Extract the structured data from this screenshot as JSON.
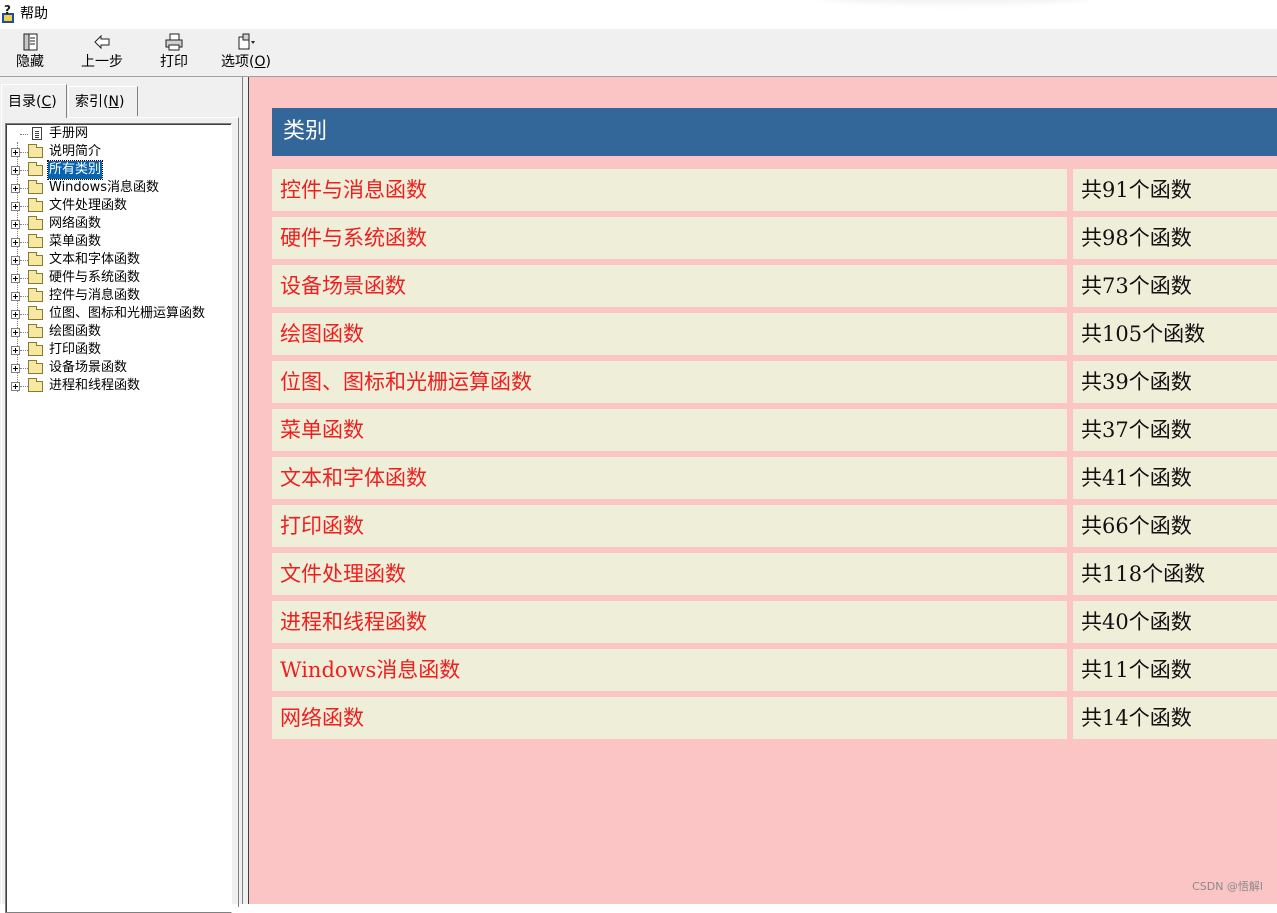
{
  "window": {
    "title": "帮助"
  },
  "toolbar": {
    "hide_label": "隐藏",
    "back_label": "上一步",
    "print_label": "打印",
    "options_label_pre": "选项(",
    "options_label_key": "O",
    "options_label_post": ")"
  },
  "tabs": {
    "contents_pre": "目录(",
    "contents_key": "C",
    "contents_post": ")",
    "index_pre": "索引(",
    "index_key": "N",
    "index_post": ")"
  },
  "tree": {
    "items": [
      {
        "label": "手册网",
        "icon": "document",
        "expandable": false,
        "selected": false
      },
      {
        "label": "说明简介",
        "icon": "folder",
        "expandable": true,
        "selected": false
      },
      {
        "label": "所有类别",
        "icon": "folder",
        "expandable": true,
        "selected": true
      },
      {
        "label": "Windows消息函数",
        "icon": "folder",
        "expandable": true,
        "selected": false
      },
      {
        "label": "文件处理函数",
        "icon": "folder",
        "expandable": true,
        "selected": false
      },
      {
        "label": "网络函数",
        "icon": "folder",
        "expandable": true,
        "selected": false
      },
      {
        "label": "菜单函数",
        "icon": "folder",
        "expandable": true,
        "selected": false
      },
      {
        "label": "文本和字体函数",
        "icon": "folder",
        "expandable": true,
        "selected": false
      },
      {
        "label": "硬件与系统函数",
        "icon": "folder",
        "expandable": true,
        "selected": false
      },
      {
        "label": "控件与消息函数",
        "icon": "folder",
        "expandable": true,
        "selected": false
      },
      {
        "label": "位图、图标和光栅运算函数",
        "icon": "folder",
        "expandable": true,
        "selected": false
      },
      {
        "label": "绘图函数",
        "icon": "folder",
        "expandable": true,
        "selected": false
      },
      {
        "label": "打印函数",
        "icon": "folder",
        "expandable": true,
        "selected": false
      },
      {
        "label": "设备场景函数",
        "icon": "folder",
        "expandable": true,
        "selected": false
      },
      {
        "label": "进程和线程函数",
        "icon": "folder",
        "expandable": true,
        "selected": false
      }
    ]
  },
  "content": {
    "header": "类别",
    "rows": [
      {
        "name": "控件与消息函数",
        "count": "共91个函数"
      },
      {
        "name": "硬件与系统函数",
        "count": "共98个函数"
      },
      {
        "name": "设备场景函数",
        "count": "共73个函数"
      },
      {
        "name": "绘图函数",
        "count": "共105个函数"
      },
      {
        "name": "位图、图标和光栅运算函数",
        "count": "共39个函数"
      },
      {
        "name": "菜单函数",
        "count": "共37个函数"
      },
      {
        "name": "文本和字体函数",
        "count": "共41个函数"
      },
      {
        "name": "打印函数",
        "count": "共66个函数"
      },
      {
        "name": "文件处理函数",
        "count": "共118个函数"
      },
      {
        "name": "进程和线程函数",
        "count": "共40个函数"
      },
      {
        "name": "Windows消息函数",
        "count": "共11个函数"
      },
      {
        "name": "网络函数",
        "count": "共14个函数"
      }
    ]
  },
  "watermark": "CSDN @悟解l",
  "colors": {
    "content_bg": "#fcc5c5",
    "header_bg": "#336699",
    "row_bg": "#efeed9",
    "link_red": "#ef1f1f",
    "selection": "#0a64ad"
  }
}
